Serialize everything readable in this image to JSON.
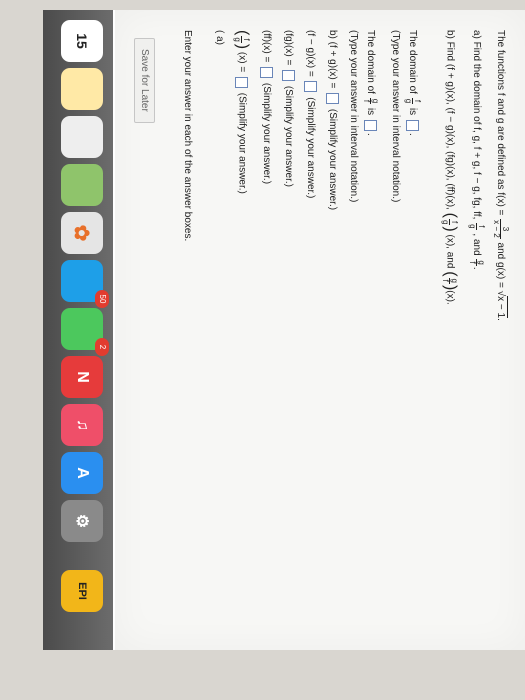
{
  "problem": {
    "intro": "The functions f and g are defined as f(x) =",
    "f_num": "3",
    "f_den": "x − 2",
    "and_g": "and g(x) =",
    "g_expr": "x − 1",
    "period": ".",
    "part_a": "a) Find the domain of f, g, f + g, f − g, fg, ff,",
    "part_a_and": ", and",
    "part_a_end": ".",
    "frac_f": "f",
    "frac_g": "g",
    "part_b": "b) Find (f + g)(x), (f − g)(x), (fg)(x), (ff)(x),",
    "part_b_x1": "(x), and",
    "part_b_x2": "(x).",
    "domain_fg_pre": "The domain of",
    "is": "is",
    "dot": ".",
    "interval_note1": "(Type your answer in interval notation.)",
    "interval_note2": "(Type your answer in interval notation.)",
    "sum_label": "b) (f + g)(x) =",
    "diff_label": "(f − g)(x) =",
    "prod_label": "(fg)(x) =",
    "ff_label": "(ff)(x) =",
    "quot_x": "(x) =",
    "simplify": "(Simplify your answer.)",
    "partial_line": "( a)",
    "enter_all": "Enter your answer in each of the answer boxes.",
    "save_later": "Save for Later"
  },
  "dock": {
    "calendar_day": "15",
    "badge_50": "50",
    "badge_2": "2",
    "last_label": "EPI"
  }
}
